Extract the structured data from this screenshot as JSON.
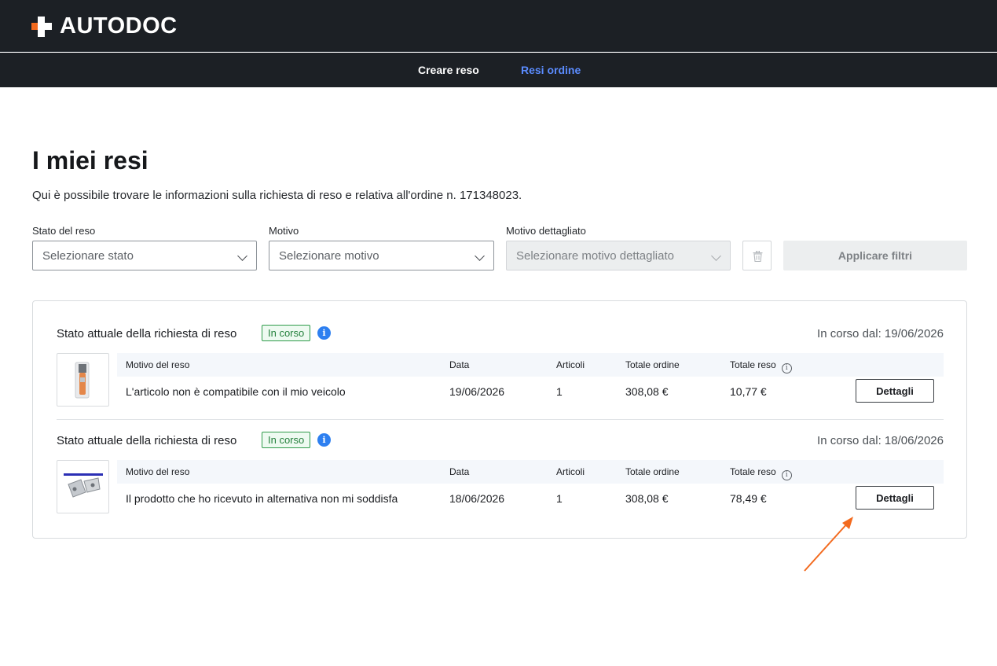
{
  "brand": {
    "name": "AUTODOC",
    "accent": "#f36a1e"
  },
  "nav": {
    "create_label": "Creare reso",
    "orders_label": "Resi ordine",
    "active": "Resi ordine"
  },
  "page": {
    "title": "I miei resi",
    "intro": "Qui è possibile trovare le informazioni sulla richiesta di reso e relativa all'ordine n. 171348023."
  },
  "filters": {
    "status": {
      "label": "Stato del reso",
      "placeholder": "Selezionare stato"
    },
    "reason": {
      "label": "Motivo",
      "placeholder": "Selezionare motivo"
    },
    "detailed_reason": {
      "label": "Motivo dettagliato",
      "placeholder": "Selezionare motivo dettagliato",
      "disabled": true
    },
    "clear_icon": "trash-icon",
    "apply_label": "Applicare filtri"
  },
  "returns": [
    {
      "state_label": "Stato attuale della richiesta di reso",
      "badge": "In corso",
      "since": "In corso dal: 19/06/2026",
      "columns": {
        "reason": "Motivo del reso",
        "date": "Data",
        "items": "Articoli",
        "order_total": "Totale ordine",
        "return_total": "Totale reso"
      },
      "reason": "L'articolo non è compatibile con il mio veicolo",
      "date": "19/06/2026",
      "items": "1",
      "order_total": "308,08 €",
      "return_total": "10,77 €",
      "details_label": "Dettagli"
    },
    {
      "state_label": "Stato attuale della richiesta di reso",
      "badge": "In corso",
      "since": "In corso dal: 18/06/2026",
      "columns": {
        "reason": "Motivo del reso",
        "date": "Data",
        "items": "Articoli",
        "order_total": "Totale ordine",
        "return_total": "Totale reso"
      },
      "reason": "Il prodotto che ho ricevuto in alternativa non mi soddisfa",
      "date": "18/06/2026",
      "items": "1",
      "order_total": "308,08 €",
      "return_total": "78,49 €",
      "details_label": "Dettagli"
    }
  ]
}
